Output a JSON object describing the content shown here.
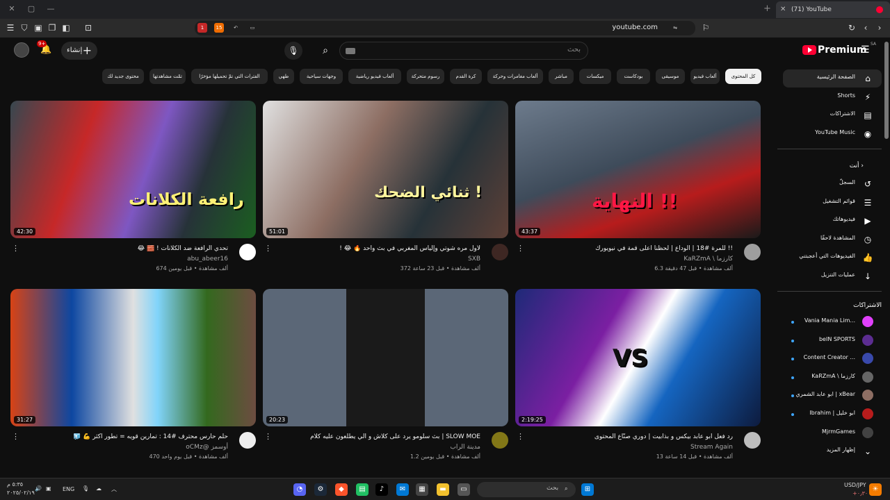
{
  "browser": {
    "tab_title": "(71) YouTube",
    "url": "youtube.com",
    "ext_badge_1": "1",
    "ext_badge_2": "15"
  },
  "header": {
    "logo_text": "Premium",
    "logo_region": "SA",
    "search_placeholder": "بحث",
    "create_label": "إنشاء",
    "notif_count": "9+"
  },
  "chips": [
    "كل المحتوى",
    "ألعاب فيديو",
    "موسيقى",
    "بودكاست",
    "ميكسات",
    "مباشر",
    "ألعاب مغامرات وحركة",
    "كرة القدم",
    "رسوم متحركة",
    "ألعاب فيديو رياضية",
    "وجهات سياحية",
    "طهي",
    "الفترات التي تمّ تحميلها مؤخرًا",
    "تمّت مشاهدتها",
    "محتوى جديد لك"
  ],
  "videos": [
    {
      "title": "للمرة #18 | الوداع | لحظنا اعلى قمة في نيويورك !!",
      "channel": "KaRZmA \\ كارزما",
      "meta": "6.3 ألف مشاهدة • قبل 47 دقيقة",
      "duration": "43:37",
      "overlay": "النهاية !!"
    },
    {
      "title": "! 😂 🔥 لأول مره شوتي وإلياس المغربي في بث واحد",
      "channel": "SXB",
      "meta": "372 ألف مشاهدة • قبل 23 ساعة",
      "duration": "51:01",
      "overlay": "ثنائي الضحك !"
    },
    {
      "title": "😂 🧱 ! تحدي الرافعة ضد الكلانات",
      "channel": "abu_abeer16",
      "meta": "674 ألف مشاهدة • قبل يومين",
      "duration": "42:30",
      "overlay": "رافعة الكلانات"
    },
    {
      "title": "رد فعل ابو عابد بيكس و بذابيت | دوري صنّاع المحتوى",
      "channel": "Stream Again",
      "meta": "13 ألف مشاهدة • قبل 14 ساعة",
      "duration": "2:19:25",
      "overlay": "VS"
    },
    {
      "title": "بث سلومو يرد على كلاش و الي يطلعون عليه كلام | SLOW MOE",
      "channel": "مدينة الراب",
      "meta": "1.2 ألف مشاهدة • قبل يومين",
      "duration": "20:23",
      "overlay": ""
    },
    {
      "title": "🧊 💪 حلم حارس محترف #14 : تمارين قويه = تطور اكثر",
      "channel": "oCMz@ أوسمز",
      "meta": "470 ألف مشاهدة • قبل يوم واحد",
      "duration": "31:27",
      "overlay": ""
    }
  ],
  "sidebar": {
    "main": [
      {
        "label": "الصفحة الرئيسية",
        "icon": "home-icon",
        "glyph": "⌂"
      },
      {
        "label": "Shorts",
        "icon": "shorts-icon",
        "glyph": "⚡"
      },
      {
        "label": "الاشتراكات",
        "icon": "subscriptions-icon",
        "glyph": "▤"
      },
      {
        "label": "YouTube Music",
        "icon": "music-icon",
        "glyph": "◉"
      }
    ],
    "you_heading": "أنت",
    "you": [
      {
        "label": "السجلّ",
        "icon": "history-icon",
        "glyph": "↺"
      },
      {
        "label": "قوائم التشغيل",
        "icon": "playlists-icon",
        "glyph": "☰"
      },
      {
        "label": "فيديوهاتك",
        "icon": "your-videos-icon",
        "glyph": "▶"
      },
      {
        "label": "المشاهدة لاحقًا",
        "icon": "watch-later-icon",
        "glyph": "◷"
      },
      {
        "label": "الفيديوهات التي أعجبتني",
        "icon": "like-icon",
        "glyph": "👍"
      },
      {
        "label": "عمليات التنزيل",
        "icon": "download-icon",
        "glyph": "↓"
      }
    ],
    "subs_heading": "الاشتراكات",
    "subs": [
      {
        "label": "Vania Mania Lim...",
        "color": "#e040fb"
      },
      {
        "label": "beIN SPORTS",
        "color": "#5c2d91"
      },
      {
        "label": "Content Creator ...",
        "color": "#3949ab"
      },
      {
        "label": "KaRZmA \\ كارزما",
        "color": "#666666"
      },
      {
        "label": "ابو عابد الشمري | xBear",
        "color": "#8d6e63"
      },
      {
        "label": "Ibrahim | ابو خليل",
        "color": "#b71c1c"
      },
      {
        "label": "MjrmGames",
        "color": "#424242"
      },
      {
        "label": "إظهار المزيد",
        "color": ""
      }
    ]
  },
  "taskbar": {
    "search_placeholder": "بحث",
    "lang": "ENG",
    "time": "٥:٣٥ م",
    "date": "٢٠٢٥/٠٢/١٩",
    "currency": "USD/JPY",
    "currency_val": "+٠٫٣٠"
  }
}
